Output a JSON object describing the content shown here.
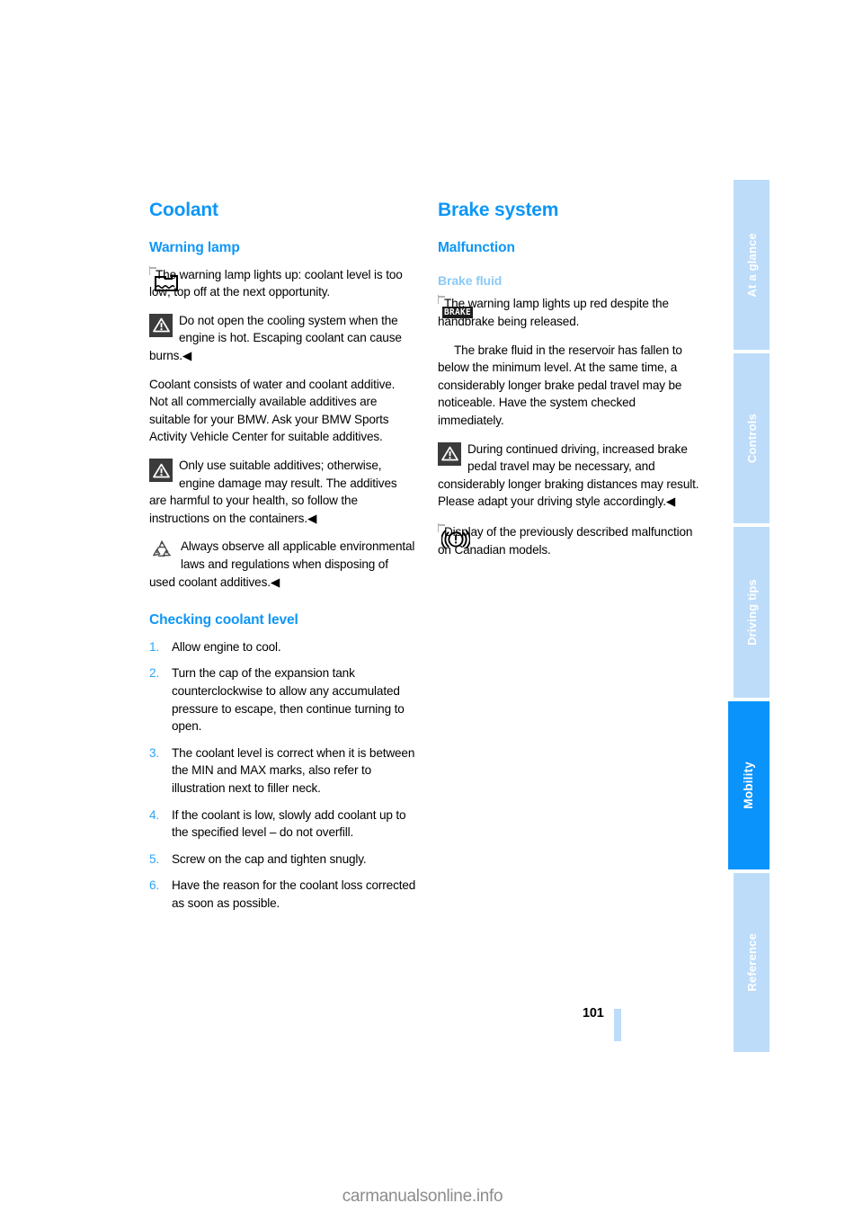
{
  "document": {
    "page_number": "101",
    "watermark": "carmanualsonline.info",
    "accent_color": "#0d96f7",
    "accent_light_color": "#8dc9f6",
    "tab_color": "#bddcfa",
    "tab_active_color": "#0a93fb"
  },
  "sidebar": {
    "tabs": [
      {
        "label": "At a glance",
        "active": false
      },
      {
        "label": "Controls",
        "active": false
      },
      {
        "label": "Driving tips",
        "active": false
      },
      {
        "label": "Mobility",
        "active": true
      },
      {
        "label": "Reference",
        "active": false
      }
    ]
  },
  "left_column": {
    "title": "Coolant",
    "warning_lamp": {
      "heading": "Warning lamp",
      "lamp_icon_name": "coolant-level-lamp-icon",
      "lamp_text": "The warning lamp lights up: coolant level is too low; top off at the next opportunity.",
      "caution_icon_name": "warning-triangle-icon",
      "caution_text": "Do not open the cooling system when the engine is hot. Escaping coolant can cause burns.◀",
      "paragraph": "Coolant consists of water and coolant additive. Not all commercially available additives are suitable for your BMW. Ask your BMW Sports Activity Vehicle Center for suitable additives.",
      "caution2_icon_name": "warning-triangle-icon",
      "caution2_text": "Only use suitable additives; otherwise, engine damage may result. The additives are harmful to your health, so follow the instructions on the containers.◀",
      "recycle_icon_name": "recycling-icon",
      "recycle_text": "Always observe all applicable environmental laws and regulations when disposing of used coolant additives.◀"
    },
    "checking_level": {
      "heading": "Checking coolant level",
      "steps": [
        {
          "num": "1.",
          "text": "Allow engine to cool."
        },
        {
          "num": "2.",
          "text": "Turn the cap of the expansion tank counterclockwise to allow any accumulated pressure to escape, then continue turning to open."
        },
        {
          "num": "3.",
          "text": "The coolant level is correct when it is between the MIN and MAX marks, also refer to illustration next to filler neck."
        },
        {
          "num": "4.",
          "text": "If the coolant is low, slowly add coolant up to the specified level – do not overfill."
        },
        {
          "num": "5.",
          "text": "Screw on the cap and tighten snugly."
        },
        {
          "num": "6.",
          "text": "Have the reason for the coolant loss corrected as soon as possible."
        }
      ]
    }
  },
  "right_column": {
    "title": "Brake system",
    "malfunction_heading": "Malfunction",
    "brake_fluid_heading": "Brake fluid",
    "brake_lamp_icon_name": "brake-warning-lamp-icon",
    "brake_lamp_icon_text": "BRAKE",
    "brake_lamp_text": "The warning lamp lights up red despite the handbrake being released.",
    "paragraph": "The brake fluid in the reservoir has fallen to below the minimum level. At the same time, a considerably longer brake pedal travel may be noticeable. Have the system checked immediately.",
    "caution_icon_name": "warning-triangle-icon",
    "caution_text": "During continued driving, increased brake pedal travel may be necessary, and considerably longer braking distances may result. Please adapt your driving style accordingly.◀",
    "canadian_icon_name": "brake-circle-exclamation-lamp-icon",
    "canadian_text": "Display of the previously described malfunction on Canadian models."
  }
}
